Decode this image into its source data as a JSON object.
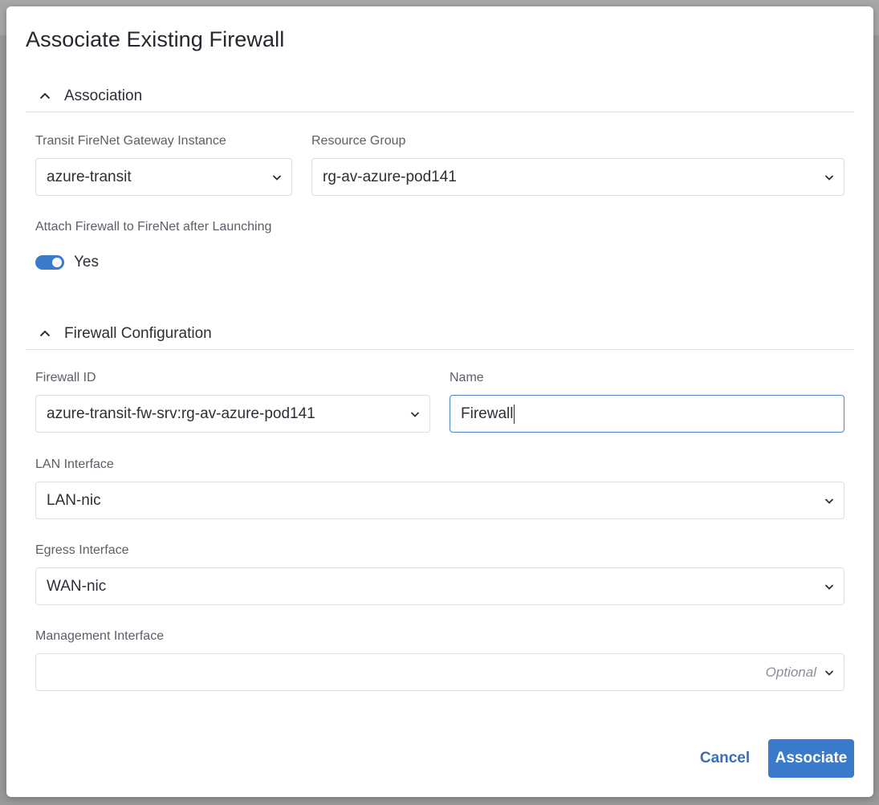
{
  "dialog": {
    "title": "Associate Existing Firewall",
    "sections": {
      "association": {
        "label": "Association"
      },
      "firewall_configuration": {
        "label": "Firewall Configuration"
      }
    },
    "fields": {
      "transit_gateway": {
        "label": "Transit FireNet Gateway Instance",
        "value": "azure-transit"
      },
      "resource_group": {
        "label": "Resource Group",
        "value": "rg-av-azure-pod141"
      },
      "attach_firewall": {
        "label": "Attach Firewall to FireNet after Launching",
        "toggle_text": "Yes",
        "enabled": true
      },
      "firewall_id": {
        "label": "Firewall ID",
        "value": "azure-transit-fw-srv:rg-av-azure-pod141"
      },
      "name": {
        "label": "Name",
        "value": "Firewall"
      },
      "lan_interface": {
        "label": "LAN Interface",
        "value": "LAN-nic"
      },
      "egress_interface": {
        "label": "Egress Interface",
        "value": "WAN-nic"
      },
      "management_interface": {
        "label": "Management Interface",
        "value": "",
        "placeholder": "Optional"
      }
    },
    "buttons": {
      "cancel": "Cancel",
      "associate": "Associate"
    },
    "icons": {
      "section_toggle": "chevron-up-icon",
      "select_caret": "chevron-down-icon"
    },
    "colors": {
      "primary": "#3a7acb",
      "link": "#3a6fb3",
      "focus_border": "#4a86c8"
    }
  }
}
